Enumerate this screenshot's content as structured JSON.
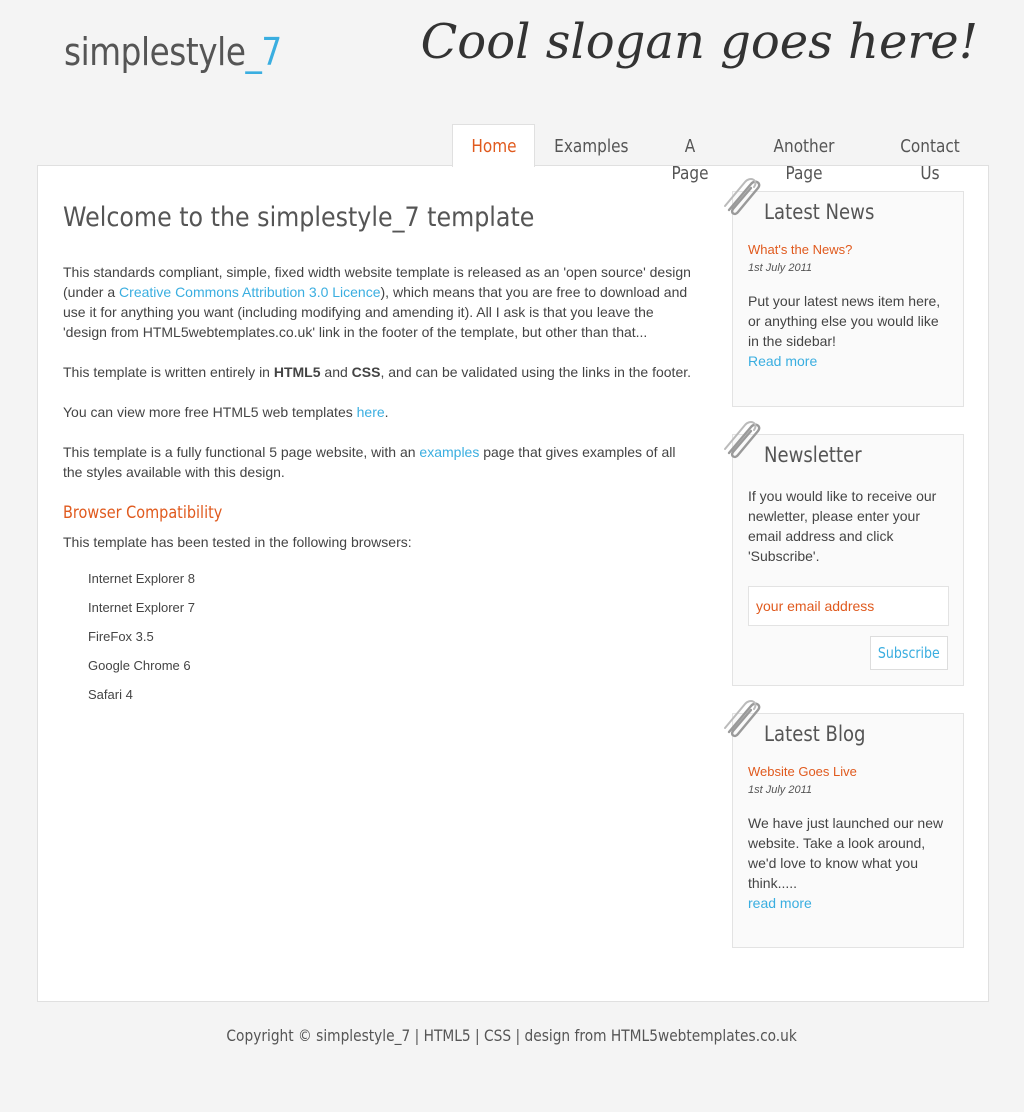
{
  "header": {
    "logo_main": "simplestyle",
    "logo_accent": "_7",
    "slogan": "Cool slogan goes here!"
  },
  "menu": {
    "items": [
      {
        "line1": "Home",
        "line2": ""
      },
      {
        "line1": "Examples",
        "line2": ""
      },
      {
        "line1": "A",
        "line2": "Page"
      },
      {
        "line1": "Another",
        "line2": "Page"
      },
      {
        "line1": "Contact",
        "line2": "Us"
      }
    ],
    "active_index": 0
  },
  "content": {
    "title": "Welcome to the simplestyle_7 template",
    "p1_before": "This standards compliant, simple, fixed width website template is released as an 'open source' design (under a ",
    "p1_link": "Creative Commons Attribution 3.0 Licence",
    "p1_after": "), which means that you are free to download and use it for anything you want (including modifying and amending it). All I ask is that you leave the 'design from HTML5webtemplates.co.uk' link in the footer of the template, but other than that...",
    "p2_before": "This template is written entirely in ",
    "p2_bold1": "HTML5",
    "p2_mid": " and ",
    "p2_bold2": "CSS",
    "p2_after": ", and can be validated using the links in the footer.",
    "p3_before": "You can view more free HTML5 web templates ",
    "p3_link": "here",
    "p3_after": ".",
    "p4_before": "This template is a fully functional 5 page website, with an ",
    "p4_link": "examples",
    "p4_after": " page that gives examples of all the styles available with this design.",
    "compat_title": "Browser Compatibility",
    "compat_text": "This template has been tested in the following browsers:",
    "browsers": [
      "Internet Explorer 8",
      "Internet Explorer 7",
      "FireFox 3.5",
      "Google Chrome 6",
      "Safari 4"
    ]
  },
  "sidebar": {
    "news": {
      "title": "Latest News",
      "item_title": "What's the News?",
      "item_date": "1st July 2011",
      "item_text": "Put your latest news item here, or anything else you would like in the sidebar!",
      "link": "Read more"
    },
    "newsletter": {
      "title": "Newsletter",
      "text": "If you would like to receive our newletter, please enter your email address and click 'Subscribe'.",
      "email_value": "your email address",
      "button_label": "Subscribe"
    },
    "blog": {
      "title": "Latest Blog",
      "item_title": "Website Goes Live",
      "item_date": "1st July 2011",
      "item_text": "We have just launched our new website. Take a look around, we'd love to know what you think.....",
      "link": "read more"
    }
  },
  "footer": {
    "text": "Copyright © simplestyle_7 | HTML5 | CSS | design from HTML5webtemplates.co.uk"
  },
  "colors": {
    "accent_blue": "#3aaee0",
    "accent_orange": "#e05a1e",
    "background": "#f4f4f4"
  }
}
